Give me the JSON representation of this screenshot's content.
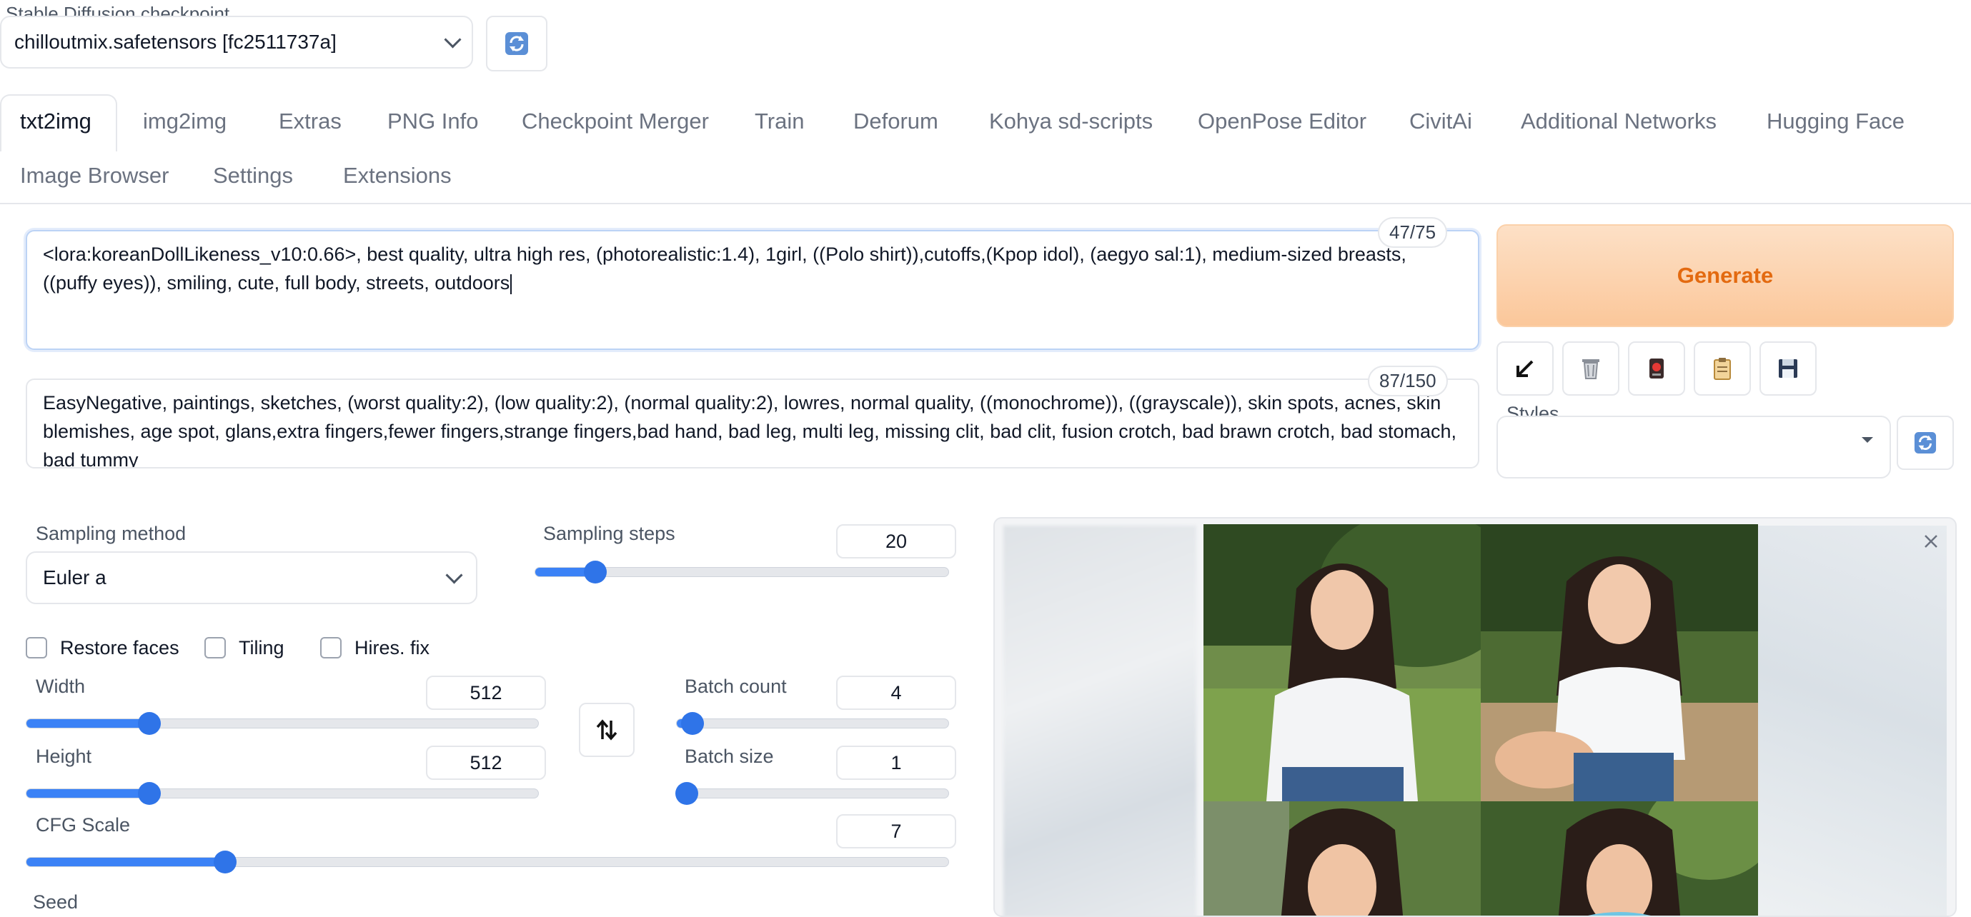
{
  "checkpoint": {
    "label": "Stable Diffusion checkpoint",
    "value": "chilloutmix.safetensors [fc2511737a]"
  },
  "tabs": [
    {
      "label": "txt2img"
    },
    {
      "label": "img2img"
    },
    {
      "label": "Extras"
    },
    {
      "label": "PNG Info"
    },
    {
      "label": "Checkpoint Merger"
    },
    {
      "label": "Train"
    },
    {
      "label": "Deforum"
    },
    {
      "label": "Kohya sd-scripts"
    },
    {
      "label": "OpenPose Editor"
    },
    {
      "label": "CivitAi"
    },
    {
      "label": "Additional Networks"
    },
    {
      "label": "Hugging Face"
    },
    {
      "label": "Image Browser"
    },
    {
      "label": "Settings"
    },
    {
      "label": "Extensions"
    }
  ],
  "prompt": {
    "text": "<lora:koreanDollLikeness_v10:0.66>, best quality, ultra high res, (photorealistic:1.4), 1girl, ((Polo shirt)),cutoffs,(Kpop idol), (aegyo sal:1), medium-sized breasts, ((puffy eyes)), smiling, cute, full body, streets, outdoors",
    "counter": "47/75"
  },
  "negative_prompt": {
    "text": "EasyNegative, paintings, sketches, (worst quality:2), (low quality:2), (normal quality:2), lowres, normal quality, ((monochrome)), ((grayscale)), skin spots, acnes, skin blemishes, age spot, glans,extra fingers,fewer fingers,strange fingers,bad hand, bad leg, multi leg, missing clit, bad clit, fusion crotch, bad brawn crotch, bad stomach, bad tummy",
    "counter": "87/150"
  },
  "generate": {
    "label": "Generate"
  },
  "toolbar": {
    "icons": [
      "arrow-down-left-icon",
      "trash-icon",
      "model-card-icon",
      "clipboard-icon",
      "save-icon"
    ]
  },
  "styles": {
    "label": "Styles",
    "value": ""
  },
  "sampling": {
    "method_label": "Sampling method",
    "method_value": "Euler a",
    "steps_label": "Sampling steps",
    "steps_value": "20"
  },
  "options": {
    "restore_faces": "Restore faces",
    "tiling": "Tiling",
    "hires_fix": "Hires. fix"
  },
  "size": {
    "width_label": "Width",
    "width_value": "512",
    "height_label": "Height",
    "height_value": "512"
  },
  "batch": {
    "count_label": "Batch count",
    "count_value": "4",
    "size_label": "Batch size",
    "size_value": "1"
  },
  "cfg": {
    "label": "CFG Scale",
    "value": "7"
  },
  "seed": {
    "label": "Seed"
  },
  "colors": {
    "accent": "#3b82f6",
    "generate_text": "#e36a10",
    "generate_bg": "#fbc79a"
  }
}
